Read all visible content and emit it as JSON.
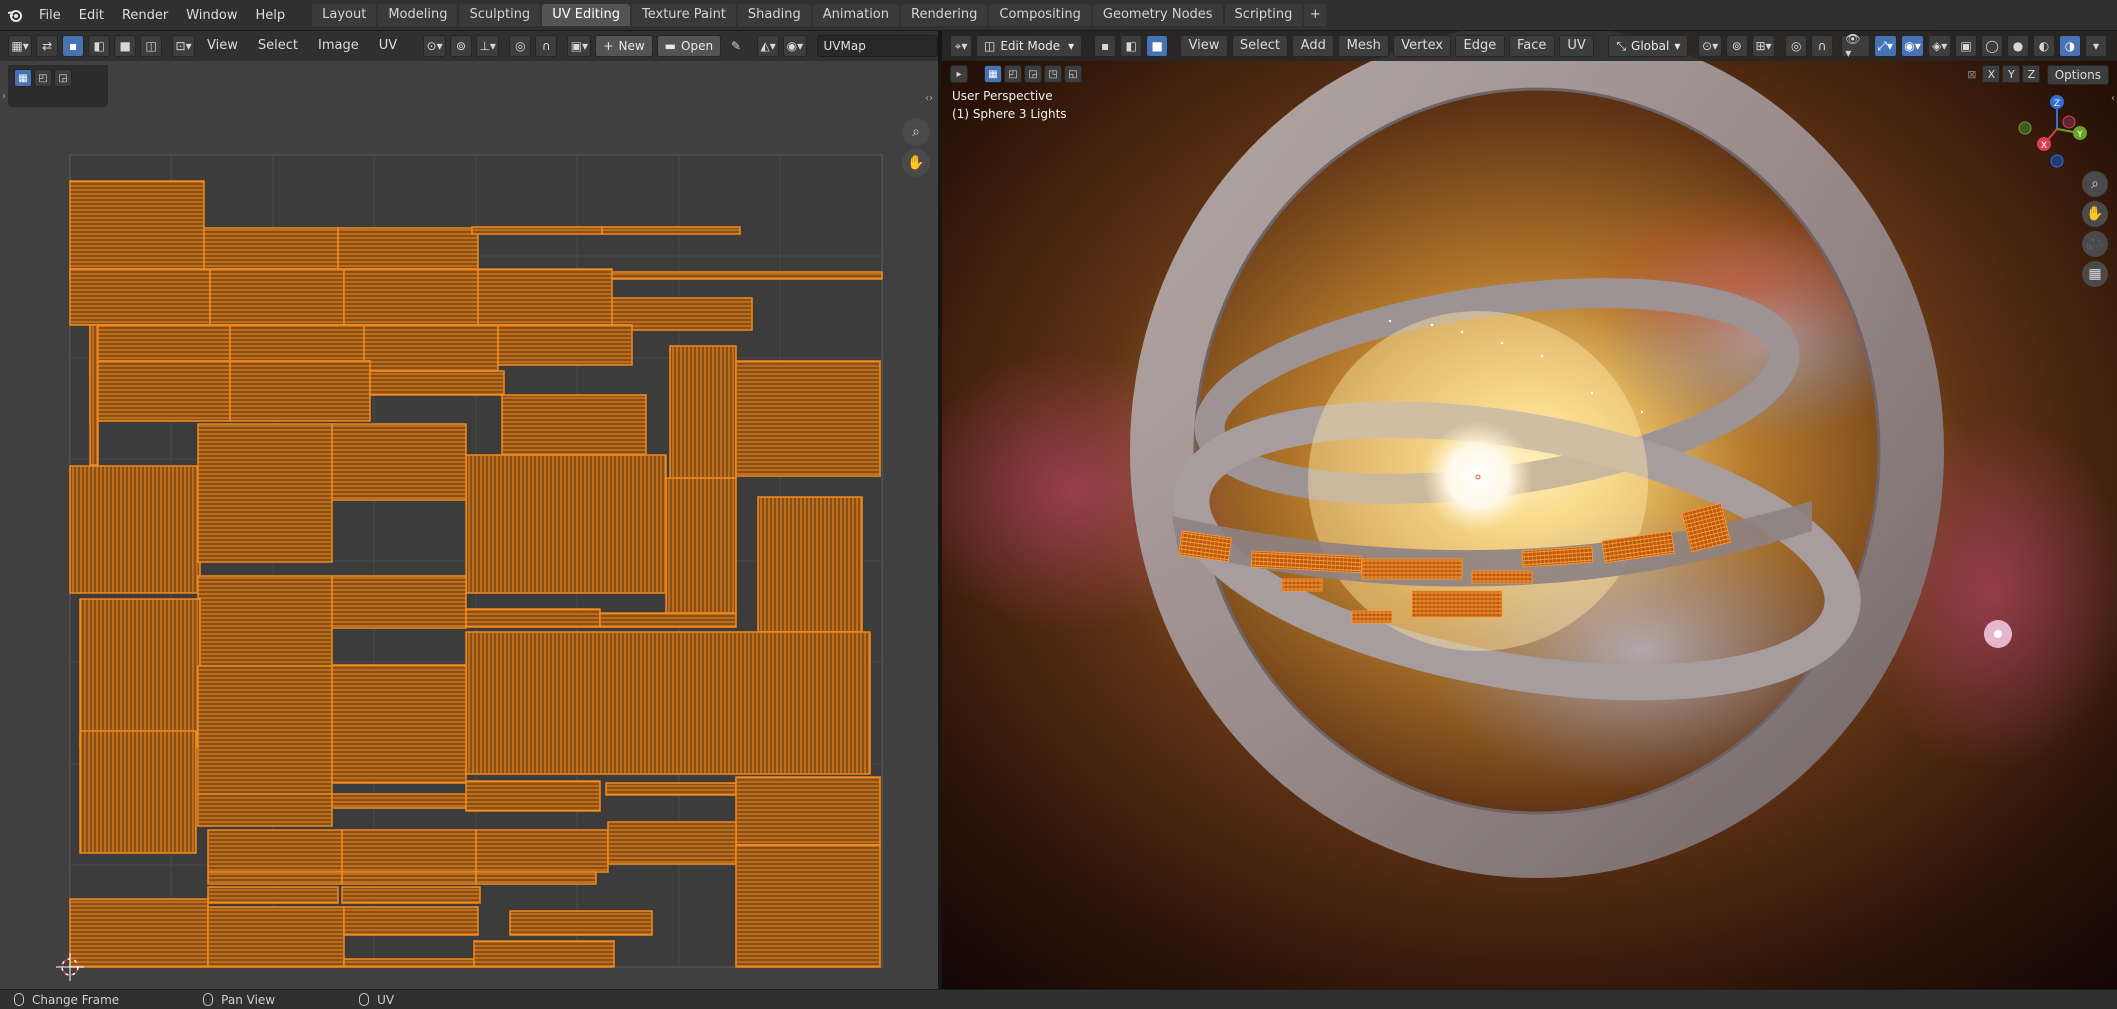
{
  "menubar": {
    "items": [
      "File",
      "Edit",
      "Render",
      "Window",
      "Help"
    ]
  },
  "workspaces": [
    {
      "label": "Layout",
      "active": false
    },
    {
      "label": "Modeling",
      "active": false
    },
    {
      "label": "Sculpting",
      "active": false
    },
    {
      "label": "UV Editing",
      "active": true
    },
    {
      "label": "Texture Paint",
      "active": false
    },
    {
      "label": "Shading",
      "active": false
    },
    {
      "label": "Animation",
      "active": false
    },
    {
      "label": "Rendering",
      "active": false
    },
    {
      "label": "Compositing",
      "active": false
    },
    {
      "label": "Geometry Nodes",
      "active": false
    },
    {
      "label": "Scripting",
      "active": false
    }
  ],
  "uv_editor": {
    "menus": [
      "View",
      "Select",
      "Image",
      "UV"
    ],
    "new_label": "New",
    "open_label": "Open",
    "uvmap_name": "UVMap"
  },
  "viewport": {
    "mode": "Edit Mode",
    "menus": [
      "View",
      "Select",
      "Add",
      "Mesh",
      "Vertex",
      "Edge",
      "Face",
      "UV"
    ],
    "orientation": "Global",
    "perspective_label": "User Perspective",
    "object_label": "(1) Sphere 3 Lights",
    "options_label": "Options",
    "axis_buttons": [
      "X",
      "Y",
      "Z"
    ],
    "gizmo_axes": {
      "x": "X",
      "y": "Y",
      "z": "Z"
    }
  },
  "statusbar": {
    "items": [
      "Change Frame",
      "Pan View",
      "UV"
    ]
  },
  "colors": {
    "uv_orange": "#f28a1f",
    "active_tab": "#545454",
    "select_blue": "#4772b3"
  }
}
